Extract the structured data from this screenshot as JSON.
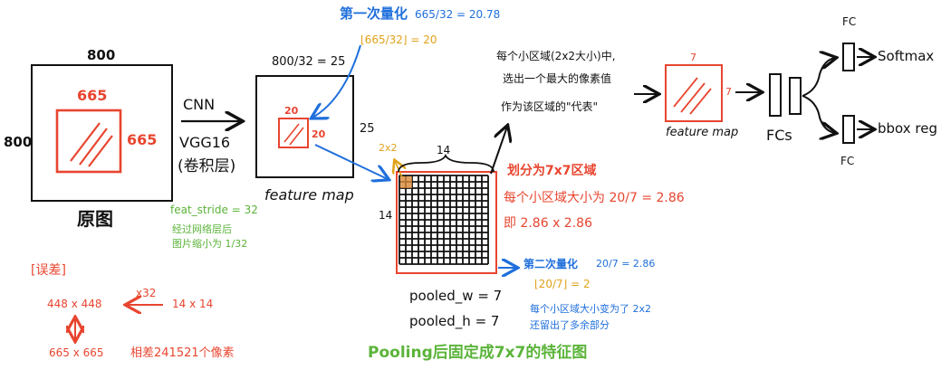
{
  "colors": {
    "ink": "#111111",
    "red": "#e8452f",
    "blue": "#1f6fdc",
    "orange": "#e0a21a",
    "green": "#5bb43a"
  },
  "original": {
    "top_size": "800",
    "side_size": "800",
    "roi_top": "665",
    "roi_side": "665",
    "caption": "原图"
  },
  "cnn": {
    "line1": "CNN",
    "line2": "VGG16",
    "line3": "(卷积层)"
  },
  "feat_stride": {
    "formula": "feat_stride = 32",
    "note1": "经过网络层后",
    "note2": "图片缩小为 1/32"
  },
  "feature_map1": {
    "top_label": "800/32 = 25",
    "side_label": "25",
    "roi_top": "20",
    "roi_side": "20",
    "caption": "feature map"
  },
  "quant1": {
    "title": "第一次量化",
    "formula": "665/32 = 20.78",
    "floor": "⌊665/32⌋ = 20"
  },
  "grid": {
    "top_label": "14",
    "side_label": "14",
    "cell_label": "2x2",
    "pooled_w": "pooled_w = 7",
    "pooled_h": "pooled_h = 7"
  },
  "division": {
    "line1": "划分为7x7区域",
    "line2": "每个小区域大小为 20/7 = 2.86",
    "line3": "即 2.86 x 2.86"
  },
  "quant2": {
    "title": "第二次量化",
    "formula": "20/7 = 2.86",
    "floor": "⌊20/7⌋ = 2",
    "note1": "每个小区域大小变为了 2x2",
    "note2": "还留出了多余部分"
  },
  "max_note": {
    "line1": "每个小区域(2x2大小)中,",
    "line2": "选出一个最大的像素值",
    "line3": "作为该区域的\"代表\""
  },
  "feature_map2": {
    "top_label": "7",
    "side_label": "7",
    "caption": "feature map"
  },
  "fcs": {
    "caption": "FCs",
    "fc_top": "FC",
    "fc_bottom": "FC",
    "softmax": "Softmax",
    "bbox": "bbox reg"
  },
  "pooling_caption": "Pooling后固定成7x7的特征图",
  "error": {
    "title": "[误差]",
    "from": "448 x 448",
    "factor": "x32",
    "grid": "14 x 14",
    "to": "665 x 665",
    "diff": "相差241521个像素"
  }
}
